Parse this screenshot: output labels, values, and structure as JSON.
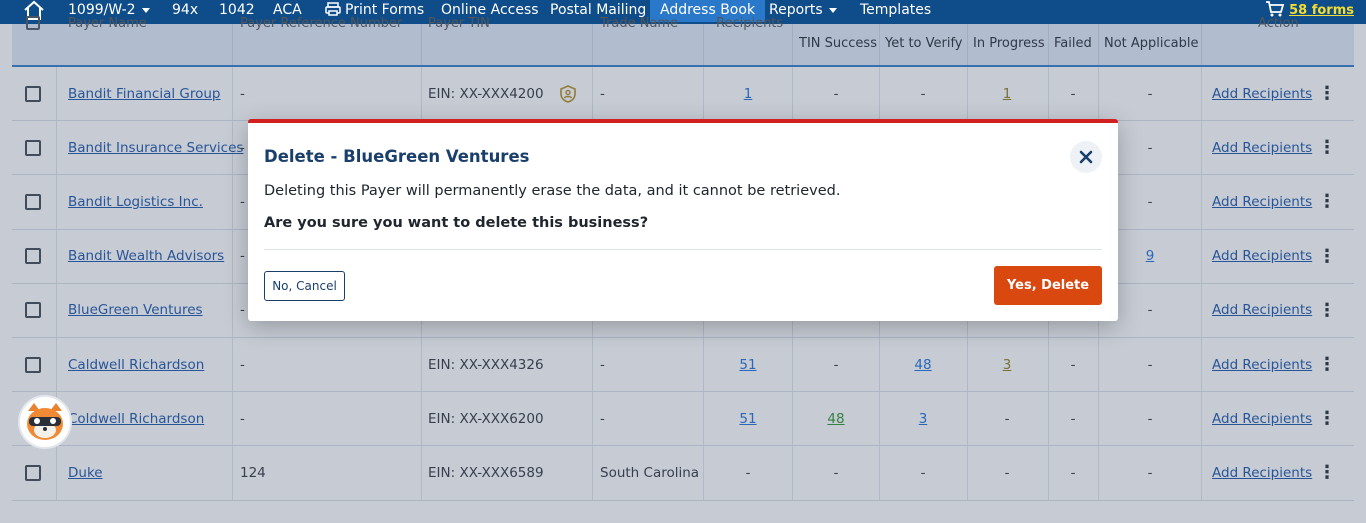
{
  "nav": {
    "items": [
      {
        "label": "1099/W-2",
        "has_caret": true
      },
      {
        "label": "94x"
      },
      {
        "label": "1042"
      },
      {
        "label": "ACA"
      },
      {
        "label": "Print Forms"
      },
      {
        "label": "Online Access"
      },
      {
        "label": "Postal Mailing"
      },
      {
        "label": "Address Book",
        "active": true
      },
      {
        "label": "Reports",
        "has_caret": true
      },
      {
        "label": "Templates"
      }
    ],
    "cart_count": "58 forms"
  },
  "table": {
    "headers": {
      "payer_name": "Payer Name",
      "payer_ref": "Payer Reference Number",
      "payer_tin": "Payer TIN",
      "trade_name": "Trade Name",
      "recipients": "Recipients",
      "tin_success": "TIN Success",
      "yet_to_verify": "Yet to Verify",
      "in_progress": "In Progress",
      "failed": "Failed",
      "not_applicable": "Not Applicable",
      "action": "Action"
    },
    "rows": [
      {
        "name": "Bandit Financial Group",
        "ref": "-",
        "tin": "EIN: XX-XXX4200",
        "trade": "-",
        "recipients": "1",
        "tin_success": "-",
        "yet": "-",
        "in_progress": "1",
        "failed": "-",
        "na": "-",
        "action": "Add Recipients"
      },
      {
        "name": "Bandit Insurance Services",
        "ref": "-",
        "tin": "",
        "trade": "",
        "recipients": "",
        "tin_success": "",
        "yet": "",
        "in_progress": "",
        "failed": "",
        "na": "-",
        "action": "Add Recipients"
      },
      {
        "name": "Bandit Logistics Inc.",
        "ref": "-",
        "tin": "",
        "trade": "",
        "recipients": "",
        "tin_success": "",
        "yet": "",
        "in_progress": "",
        "failed": "",
        "na": "-",
        "action": "Add Recipients"
      },
      {
        "name": "Bandit Wealth Advisors",
        "ref": "-",
        "tin": "",
        "trade": "",
        "recipients": "",
        "tin_success": "",
        "yet": "",
        "in_progress": "",
        "failed": "",
        "na": "9",
        "action": "Add Recipients"
      },
      {
        "name": "BlueGreen Ventures",
        "ref": "-",
        "tin": "",
        "trade": "",
        "recipients": "",
        "tin_success": "",
        "yet": "",
        "in_progress": "",
        "failed": "",
        "na": "-",
        "action": "Add Recipients"
      },
      {
        "name": "Caldwell Richardson",
        "ref": "-",
        "tin": "EIN: XX-XXX4326",
        "trade": "-",
        "recipients": "51",
        "tin_success": "-",
        "yet": "48",
        "in_progress": "3",
        "failed": "-",
        "na": "-",
        "action": "Add Recipients"
      },
      {
        "name": "Coldwell Richardson",
        "ref": "-",
        "tin": "EIN: XX-XXX6200",
        "trade": "-",
        "recipients": "51",
        "tin_success": "48",
        "yet": "3",
        "in_progress": "-",
        "failed": "-",
        "na": "-",
        "action": "Add Recipients"
      },
      {
        "name": "Duke",
        "ref": "124",
        "tin": "EIN: XX-XXX6589",
        "trade": "South Carolina",
        "recipients": "-",
        "tin_success": "-",
        "yet": "-",
        "in_progress": "-",
        "failed": "-",
        "na": "-",
        "action": "Add Recipients"
      }
    ]
  },
  "modal": {
    "title": "Delete - BlueGreen Ventures",
    "message": "Deleting this Payer will permanently erase the data, and it cannot be retrieved.",
    "question": "Are you sure you want to delete this business?",
    "cancel_label": "No, Cancel",
    "delete_label": "Yes, Delete"
  },
  "colors": {
    "nav_bg": "#0f4c8a",
    "active_tab": "#2a78c9",
    "delete_btn": "#d9480f",
    "modal_accent": "#d21f1f"
  }
}
